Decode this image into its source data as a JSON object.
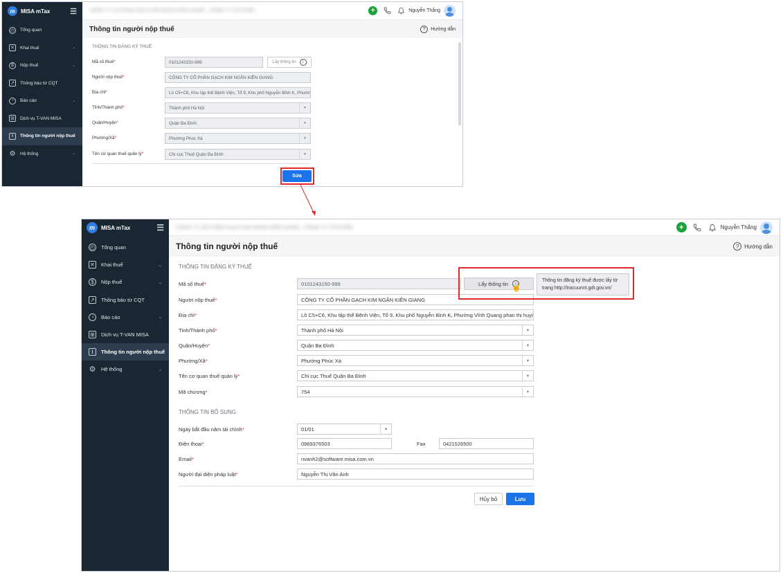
{
  "app": {
    "brand": "MISA mTax",
    "logo_glyph": "m",
    "blurred_title": "CÔNG TY CỔ PHẦN GẠCH KIM NGÂN KIÊN GIANG - CÔNG TY CỔ PHẦN"
  },
  "topbar": {
    "user_name": "Nguyễn Thắng",
    "icons": [
      "plus-circle-icon",
      "phone-icon",
      "bell-icon",
      "avatar"
    ]
  },
  "sidebar": {
    "items": [
      {
        "label": "Tổng quan",
        "icon": "dashboard-icon"
      },
      {
        "label": "Khai thuế",
        "icon": "declare-icon",
        "has_sub": true
      },
      {
        "label": "Nộp thuế",
        "icon": "dollar-icon",
        "has_sub": true
      },
      {
        "label": "Thông báo từ CQT",
        "icon": "notice-icon"
      },
      {
        "label": "Báo cáo",
        "icon": "report-icon",
        "has_sub": true
      },
      {
        "label": "Dịch vụ T-VAN MISA",
        "icon": "grid-icon"
      },
      {
        "label": "Thông tin người nộp thuế",
        "icon": "info-icon",
        "active": true
      },
      {
        "label": "Hệ thống",
        "icon": "gear-icon",
        "has_sub": true
      }
    ]
  },
  "page": {
    "title": "Thông tin người nộp thuế",
    "help": "Hướng dẫn"
  },
  "section1": "THÔNG TIN ĐĂNG KÝ THUẾ",
  "section2": "THÔNG TIN BỔ SUNG",
  "fields": {
    "mst": {
      "label": "Mã số thuế",
      "value": "0101243150-999"
    },
    "name": {
      "label": "Người nộp thuế",
      "value": "CÔNG TY CỔ PHẦN GẠCH KIM NGÂN KIÊN GIANG"
    },
    "addr": {
      "label": "Địa chỉ",
      "value_short": "Lô C5+C6, Khu tập thể Bệnh Viện, Tổ 9, Khu phố Nguyễn Bỉnh K, Phườn",
      "value": "Lô C5+C6, Khu tập thể Bệnh Viện, Tổ 9, Khu phố Nguyễn Bỉnh K, Phường Vĩnh Quang phan thị huyịwn"
    },
    "city": {
      "label": "Tỉnh/Thành phố",
      "value": "Thành phố Hà Nội"
    },
    "district": {
      "label": "Quận/Huyện",
      "value": "Quận Ba Đình"
    },
    "ward": {
      "label": "Phường/Xã",
      "value": "Phường Phúc Xá"
    },
    "office": {
      "label": "Tên cơ quan thuế quản lý",
      "value": "Chi cục Thuế Quận Ba Đình"
    },
    "chapter": {
      "label": "Mã chương",
      "value": "754"
    },
    "fiscal": {
      "label": "Ngày bắt đầu năm tài chính",
      "value": "01/01"
    },
    "phone": {
      "label": "Điện thoại",
      "value": "0969376503"
    },
    "fax": {
      "label": "Fax",
      "value": "0421526500"
    },
    "email": {
      "label": "Email",
      "value": "nvanh2@software.misa.com.vn"
    },
    "rep": {
      "label": "Người đại diện pháp luật",
      "value": "Nguyễn Thị Vân Anh"
    }
  },
  "buttons": {
    "fetch": "Lấy thông tin",
    "edit": "Sửa",
    "cancel": "Hủy bỏ",
    "save": "Lưu"
  },
  "tooltip": "Thông tin đăng ký thuế được lấy từ trang http://tracuunnt.gdt.gov.vn/",
  "colors": {
    "sidebar": "#1b2633",
    "primary": "#1a73e8",
    "highlight": "#e02a2a",
    "success": "#18a43a"
  }
}
